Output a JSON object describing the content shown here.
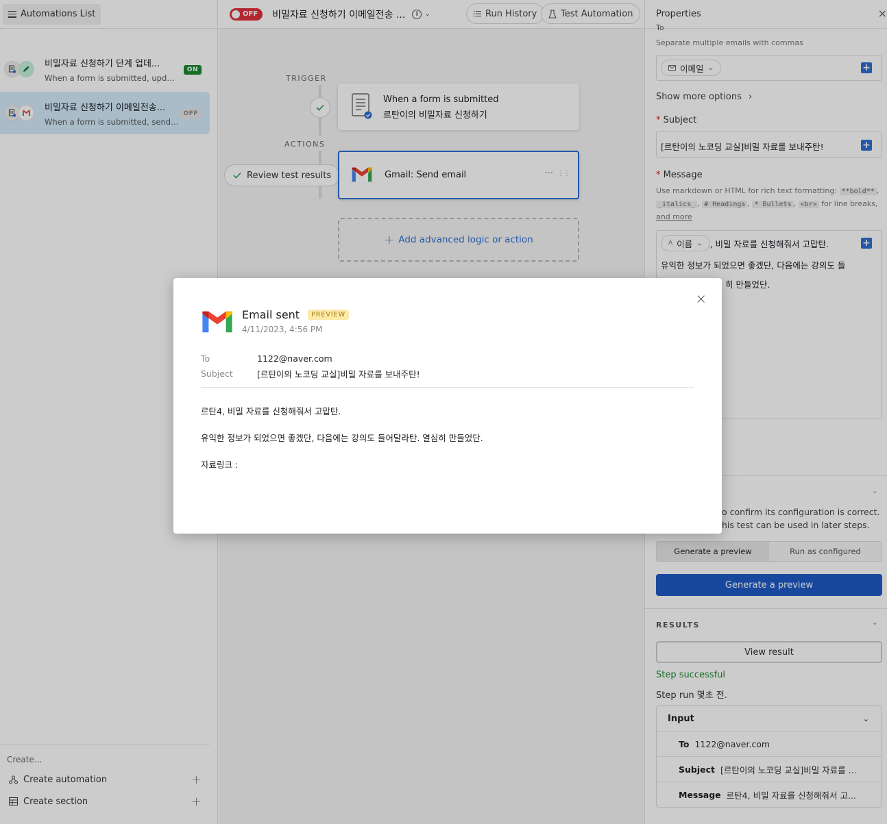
{
  "sidebar": {
    "list_button": "Automations List",
    "automations": [
      {
        "title": "비밀자료 신청하기 단계 업데...",
        "desc": "When a form is submitted, update ...",
        "status": "ON"
      },
      {
        "title": "비밀자료 신청하기 이메일전송...",
        "desc": "When a form is submitted, send an...",
        "status": "OFF"
      }
    ],
    "create_label": "Create...",
    "create_automation": "Create automation",
    "create_section": "Create section"
  },
  "canvas": {
    "toggle_label": "OFF",
    "title": "비밀자료 신청하기 이메일전송 ...",
    "run_history": "Run History",
    "test_automation": "Test Automation",
    "trigger_label": "TRIGGER",
    "actions_label": "ACTIONS",
    "trigger_line1": "When a form is submitted",
    "trigger_line2": "르탄이의 비밀자료 신청하기",
    "action_label": "Gmail: Send email",
    "action_more": "···",
    "review_results": "Review test results",
    "add_logic": "Add advanced logic or action"
  },
  "props": {
    "title": "Properties",
    "to_label": "To",
    "to_hint": "Separate multiple emails with commas",
    "to_token": "이메일",
    "show_more": "Show more options",
    "subject_label": "Subject",
    "subject_value": "[르탄이의 노코딩 교실]비밀 자료를 보내주탄!",
    "message_label": "Message",
    "message_hint_pre": "Use markdown or HTML for rich text formatting:",
    "md_bold": "**bold**",
    "md_italics": "_italics_",
    "md_headings": "# Headings",
    "md_bullets": "* Bullets",
    "md_br": "<br>",
    "message_hint_mid": "for line breaks,",
    "message_hint_link": "and more",
    "message_token": "이름",
    "message_line1_rest": ", 비밀 자료를 신청해줘서 고맙탄.",
    "message_line2": "유익한 정보가 되었으면 좋겠단, 다음에는 강의도 들",
    "message_line3_tail": "히 만들었단.",
    "test_text_line1_tail": "o confirm its configuration is correct.",
    "test_text_line2_tail": "his test can be used in later steps.",
    "seg_generate": "Generate a preview",
    "seg_run": "Run as configured",
    "generate_button": "Generate a preview",
    "results_heading": "RESULTS",
    "view_result": "View result",
    "step_successful": "Step successful",
    "step_run": "Step run 몇초 전.",
    "input_heading": "Input",
    "input_rows": [
      {
        "key": "To",
        "value": "1122@naver.com"
      },
      {
        "key": "Subject",
        "value": "[르탄이의 노코딩 교실]비밀 자료를 ..."
      },
      {
        "key": "Message",
        "value": "르탄4, 비밀 자료를 신청해줘서 고..."
      }
    ]
  },
  "modal": {
    "title": "Email sent",
    "badge": "PREVIEW",
    "date": "4/11/2023, 4:56 PM",
    "to_key": "To",
    "to_value": "1122@naver.com",
    "subject_key": "Subject",
    "subject_value": "[르탄이의 노코딩 교실]비밀 자료를 보내주탄!",
    "body_line1": "르탄4, 비밀 자료를 신청해줘서 고맙탄.",
    "body_line2": "유익한 정보가 되었으면 좋겠단, 다음에는 강의도 들어달라탄. 열심히 만들었단.",
    "body_line3": "자료링크 :"
  },
  "colors": {
    "accent_blue": "#2f6fd1",
    "primary_button": "#1e5ac6",
    "off_red": "#e0313d",
    "on_green": "#1b8a2f",
    "success_green": "#1b8a2f"
  }
}
